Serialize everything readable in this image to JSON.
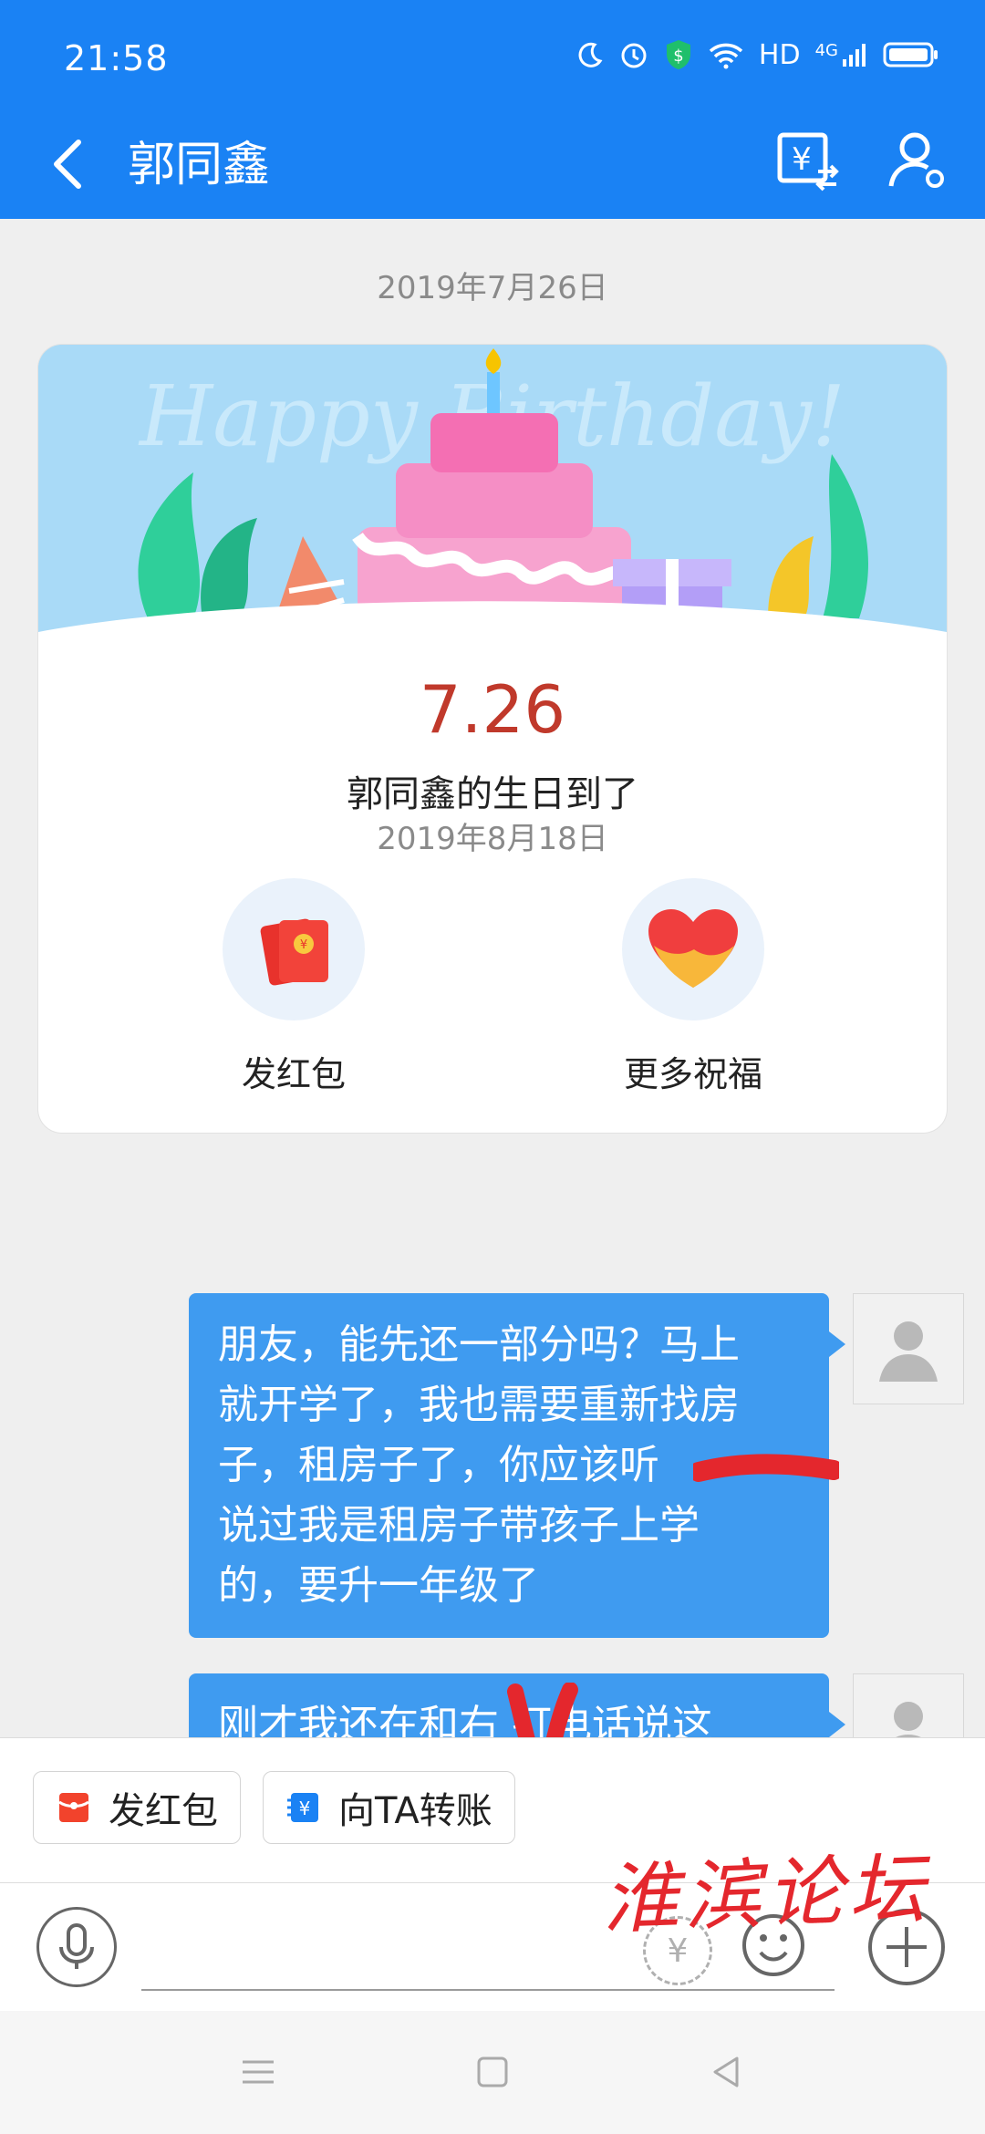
{
  "status_bar": {
    "time": "21:58",
    "network": "HD",
    "signal": "4G"
  },
  "header": {
    "title": "郭同鑫"
  },
  "chat": {
    "date_1": "2019年7月26日",
    "birthday_card": {
      "banner_text": "Happy Birthday!",
      "date": "7.26",
      "message": "郭同鑫的生日到了",
      "actions": [
        {
          "label": "发红包"
        },
        {
          "label": "更多祝福"
        }
      ]
    },
    "date_2": "2019年8月18日",
    "messages": [
      {
        "lines": [
          "朋友，能先还一部分吗？马上",
          "就开学了，我也需要重新找房",
          "子，租房子了，你应该听",
          "说过我是租房子带孩子上学",
          "的，要升一年级了"
        ]
      },
      {
        "lines": [
          "刚才我还在和右 打电话说这"
        ]
      }
    ]
  },
  "quick_actions": [
    {
      "label": "发红包",
      "icon": "red-envelope-icon"
    },
    {
      "label": "向TA转账",
      "icon": "transfer-yuan-icon"
    }
  ],
  "watermark": "淮滨论坛",
  "colors": {
    "brand_blue": "#1a82f4",
    "bubble_blue": "#3f9bf0",
    "red": "#c0392b"
  }
}
